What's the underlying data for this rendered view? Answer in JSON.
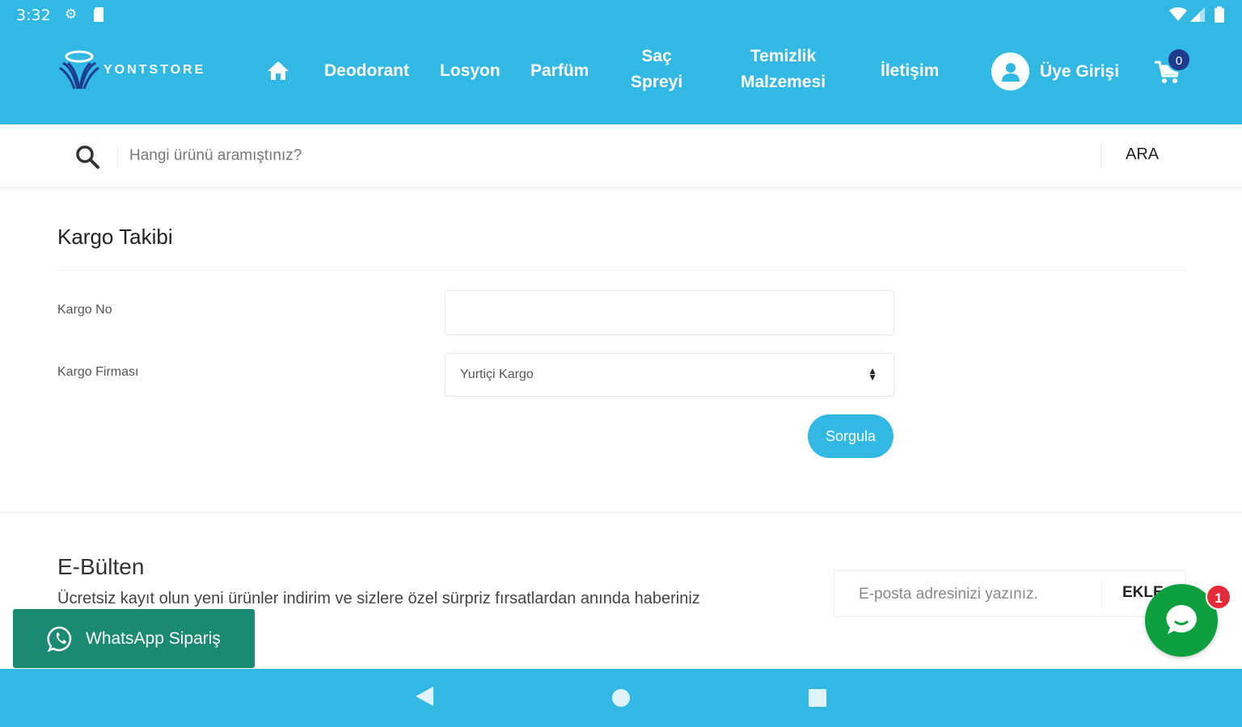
{
  "status_bar": {
    "time": "3:32"
  },
  "brand": {
    "name": "YONTSTORE"
  },
  "nav": {
    "items": [
      {
        "id": "deodorant",
        "label": "Deodorant"
      },
      {
        "id": "losyon",
        "label": "Losyon"
      },
      {
        "id": "parfum",
        "label": "Parfüm"
      },
      {
        "id": "sac",
        "line1": "Saç",
        "line2": "Spreyi"
      },
      {
        "id": "temizlik",
        "line1": "Temizlik",
        "line2": "Malzemesi"
      },
      {
        "id": "iletisim",
        "label": "İletişim"
      }
    ],
    "user_label": "Üye Girişi",
    "cart_count": "0"
  },
  "search": {
    "placeholder": "Hangi ürünü aramıştınız?",
    "button": "ARA"
  },
  "kargo": {
    "title": "Kargo Takibi",
    "no_label": "Kargo No",
    "no_value": "",
    "firma_label": "Kargo Firması",
    "firma_selected": "Yurtiçi Kargo",
    "query_button": "Sorgula"
  },
  "bulten": {
    "title": "E-Bülten",
    "description": "Ücretsiz kayıt olun yeni ürünler indirim ve sizlere özel sürpriz fırsatlardan anında haberiniz",
    "email_placeholder": "E-posta adresinizi yazınız.",
    "button": "EKLE"
  },
  "whatsapp": {
    "label": "WhatsApp Sipariş"
  },
  "chat": {
    "badge": "1"
  },
  "colors": {
    "primary": "#31b8e3",
    "whatsapp": "#1a8a72",
    "chat": "#0e9f3f",
    "badge": "#e52b3a",
    "cart_badge": "#1e3c8e"
  }
}
